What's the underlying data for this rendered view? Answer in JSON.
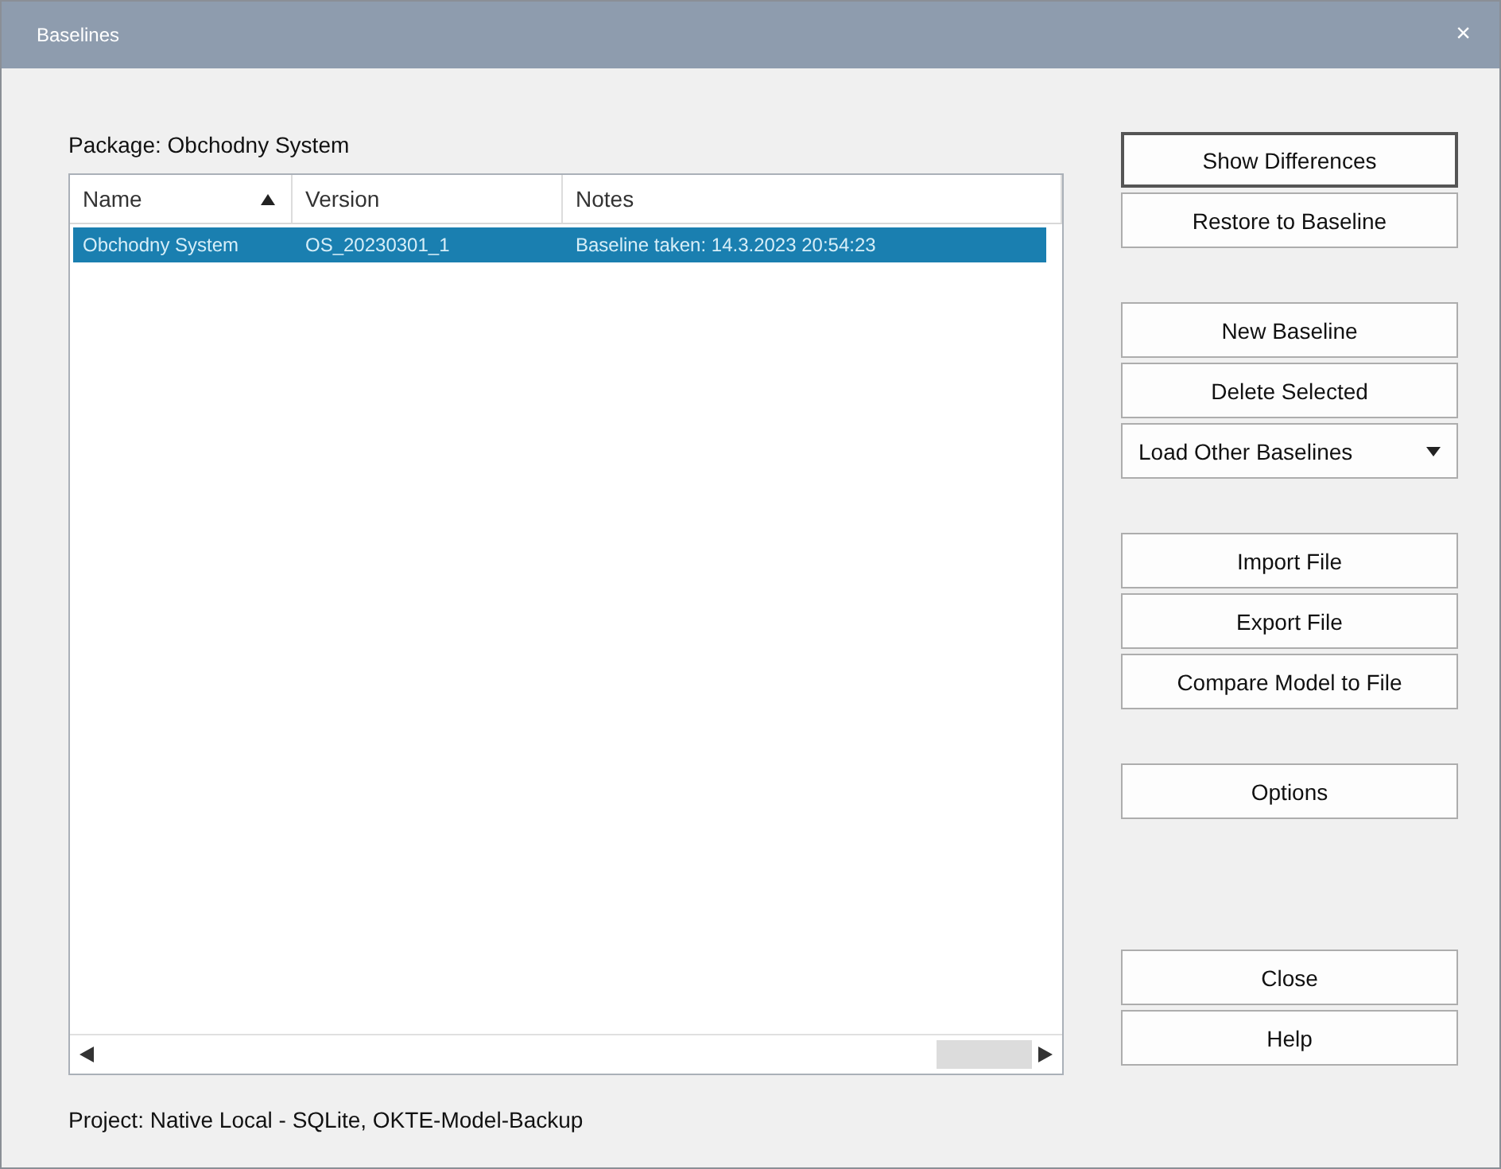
{
  "window": {
    "title": "Baselines",
    "close": "×"
  },
  "package_label": "Package: Obchodny System",
  "table": {
    "columns": [
      {
        "label": "Name",
        "sorted": true
      },
      {
        "label": "Version",
        "sorted": false
      },
      {
        "label": "Notes",
        "sorted": false
      }
    ],
    "rows": [
      {
        "cells": [
          "Obchodny System",
          "OS_20230301_1",
          "Baseline taken: 14.3.2023 20:54:23"
        ],
        "selected": true
      }
    ]
  },
  "project_label": "Project: Native Local - SQLite, OKTE-Model-Backup",
  "button_groups": [
    [
      {
        "label": "Show Differences",
        "kind": "default"
      },
      {
        "label": "Restore to Baseline",
        "kind": "normal"
      }
    ],
    [
      {
        "label": "New Baseline",
        "kind": "normal"
      },
      {
        "label": "Delete Selected",
        "kind": "normal"
      },
      {
        "label": "Load Other Baselines",
        "kind": "dropdown"
      }
    ],
    [
      {
        "label": "Import File",
        "kind": "normal"
      },
      {
        "label": "Export File",
        "kind": "normal"
      },
      {
        "label": "Compare Model to File",
        "kind": "normal"
      }
    ],
    [
      {
        "label": "Options",
        "kind": "normal"
      }
    ],
    [
      {
        "label": "Close",
        "kind": "normal"
      },
      {
        "label": "Help",
        "kind": "normal"
      }
    ]
  ]
}
